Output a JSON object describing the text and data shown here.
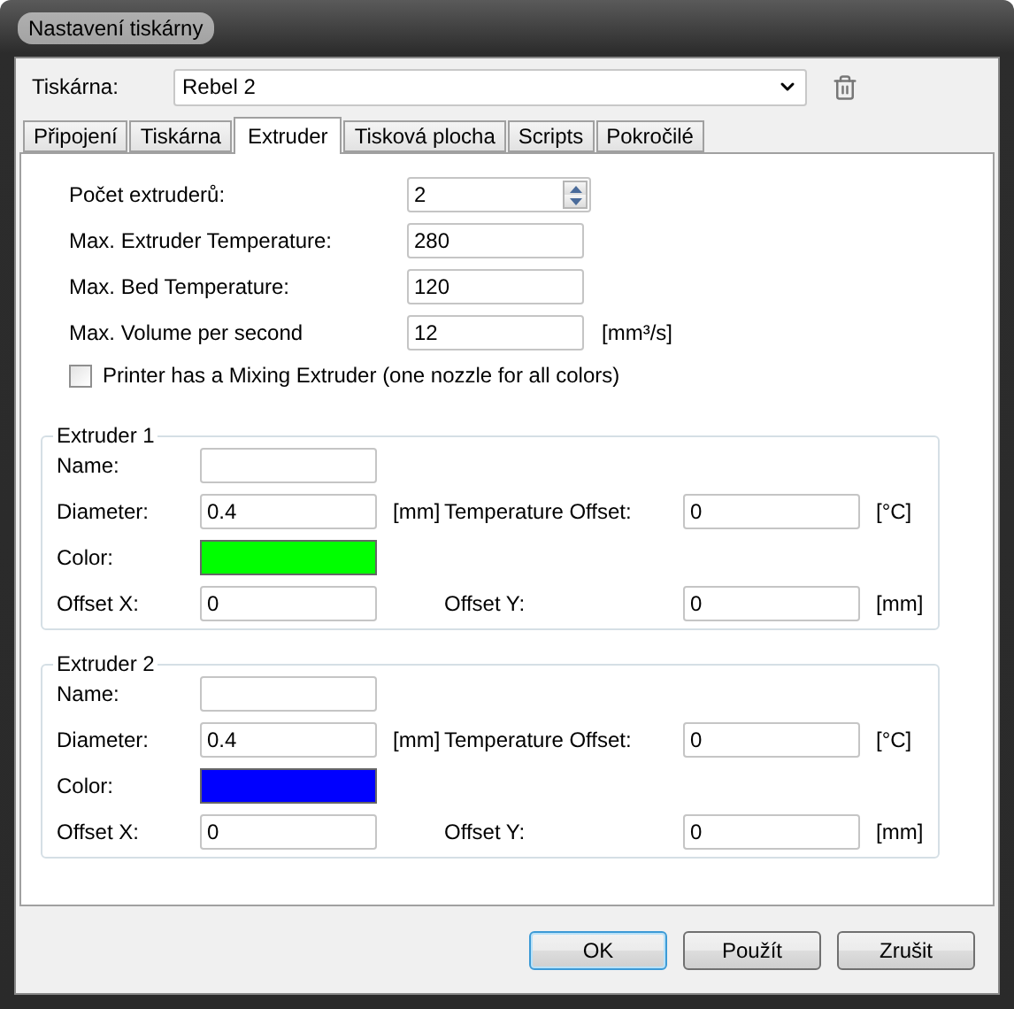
{
  "window": {
    "title": "Nastavení tiskárny"
  },
  "printer": {
    "label": "Tiskárna:",
    "value": "Rebel 2"
  },
  "tabs": [
    {
      "label": "Připojení",
      "selected": false
    },
    {
      "label": "Tiskárna",
      "selected": false
    },
    {
      "label": "Extruder",
      "selected": true
    },
    {
      "label": "Tisková plocha",
      "selected": false
    },
    {
      "label": "Scripts",
      "selected": false
    },
    {
      "label": "Pokročilé",
      "selected": false
    }
  ],
  "general": [
    {
      "kind": "spin",
      "label": "Počet extruderů:",
      "value": "2"
    },
    {
      "kind": "text",
      "label": "Max. Extruder Temperature:",
      "value": "280"
    },
    {
      "kind": "text",
      "label": "Max. Bed Temperature:",
      "value": "120"
    },
    {
      "kind": "text",
      "label": "Max. Volume per second",
      "value": "12",
      "unit": "[mm³/s]"
    }
  ],
  "mixing": {
    "label": "Printer has a Mixing Extruder (one nozzle for all colors)",
    "checked": false
  },
  "extruders": [
    {
      "title": "Extruder 1",
      "name": {
        "label": "Name:"
      },
      "diameter": {
        "label": "Diameter:",
        "value": "0.4",
        "unit": "[mm]"
      },
      "temperature_offset": {
        "label": "Temperature Offset:",
        "value": "0",
        "unit": "[°C]"
      },
      "color": {
        "label": "Color:",
        "color": "#00ff00"
      },
      "offset_x": {
        "label": "Offset X:",
        "value": "0"
      },
      "offset_y": {
        "label": "Offset Y:",
        "value": "0",
        "unit": "[mm]"
      }
    },
    {
      "title": "Extruder 2",
      "name": {
        "label": "Name:"
      },
      "diameter": {
        "label": "Diameter:",
        "value": "0.4",
        "unit": "[mm]"
      },
      "temperature_offset": {
        "label": "Temperature Offset:",
        "value": "0",
        "unit": "[°C]"
      },
      "color": {
        "label": "Color:",
        "color": "#0000ff"
      },
      "offset_x": {
        "label": "Offset X:",
        "value": "0"
      },
      "offset_y": {
        "label": "Offset Y:",
        "value": "0",
        "unit": "[mm]"
      }
    }
  ],
  "buttons": [
    {
      "label": "OK",
      "default": true
    },
    {
      "label": "Použít",
      "default": false
    },
    {
      "label": "Zrušit",
      "default": false
    }
  ]
}
